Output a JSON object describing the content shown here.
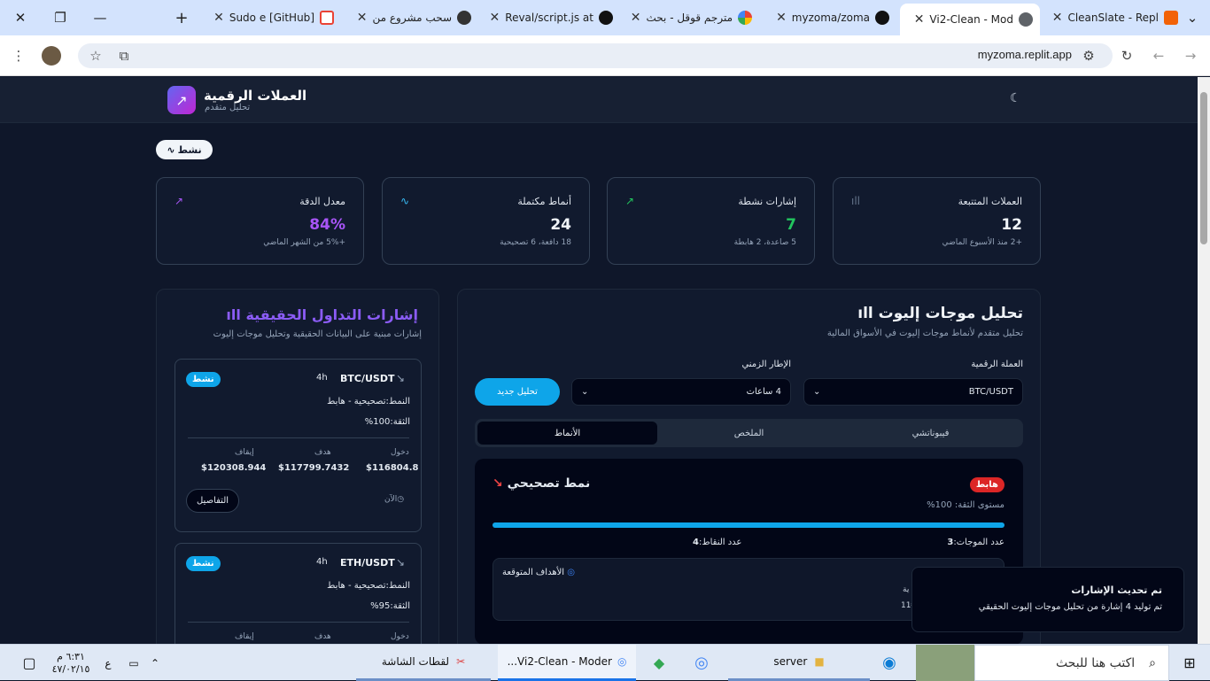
{
  "browser": {
    "tabs": [
      {
        "label": "CleanSlate - Repl",
        "active": false
      },
      {
        "label": "Vi2-Clean - Mod",
        "active": true
      },
      {
        "label": "myzoma/zoma",
        "active": false
      },
      {
        "label": "مترجم قوقل - بحث",
        "active": false
      },
      {
        "label": "Reval/script.js at",
        "active": false
      },
      {
        "label": "سحب مشروع من",
        "active": false
      },
      {
        "label": "[GitHub] Sudo e",
        "active": false
      }
    ],
    "url": "myzoma.replit.app"
  },
  "app": {
    "brand_title": "العملات الرقمية",
    "brand_subtitle": "تحليل متقدم",
    "status_label": "نشط",
    "stats": [
      {
        "title": "العملات المتتبعة",
        "value": "12",
        "note": "+2 منذ الأسبوع الماضي",
        "color": "#f1f5f9",
        "icon": "bar-chart-icon"
      },
      {
        "title": "إشارات نشطة",
        "value": "7",
        "note": "5 صاعدة، 2 هابطة",
        "color": "#22c55e",
        "icon": "trending-up-icon"
      },
      {
        "title": "أنماط مكتملة",
        "value": "24",
        "note": "18 دافعة، 6 تصحيحية",
        "color": "#f1f5f9",
        "icon": "activity-icon"
      },
      {
        "title": "معدل الدقة",
        "value": "84%",
        "note": "+5% من الشهر الماضي",
        "color": "#a855f7",
        "icon": "trending-up-icon"
      }
    ],
    "signals": {
      "title": "إشارات التداول الحقيقية",
      "subtitle": "إشارات مبنية على البيانات الحقيقية وتحليل موجات إليوت",
      "cards": [
        {
          "pair": "BTC/USDT",
          "timeframe": "4h",
          "badge": "نشط",
          "pattern_label": "النمط:",
          "pattern": "تصحيحية - هابط",
          "confidence": "الثقة:100%",
          "entry_label": "دخول",
          "target_label": "هدف",
          "stop_label": "إيقاف",
          "entry": "$116804.8",
          "target": "$117799.7432",
          "stop": "$120308.944",
          "time": "الآن",
          "details_button": "التفاصيل"
        },
        {
          "pair": "ETH/USDT",
          "timeframe": "4h",
          "badge": "نشط",
          "pattern_label": "النمط:",
          "pattern": "تصحيحية - هابط",
          "confidence": "الثقة:95%",
          "entry_label": "دخول",
          "target_label": "هدف",
          "stop_label": "إيقاف"
        }
      ]
    },
    "wave": {
      "title": "تحليل موجات إليوت",
      "subtitle": "تحليل متقدم لأنماط موجات إليوت في الأسواق المالية",
      "currency_label": "العملة الرقمية",
      "currency_value": "BTC/USDT",
      "timeframe_label": "الإطار الزمني",
      "timeframe_value": "4 ساعات",
      "analyze_button": "تحليل جديد",
      "tabs": [
        "فيبوناتشي",
        "الملخص",
        "الأنماط"
      ],
      "pattern": {
        "title": "نمط تصحيحي",
        "badge": "هابط",
        "confidence": "مستوى الثقة: 100%",
        "confidence_fraction": 1.0,
        "waves_count_label": "عدد الموجات:",
        "waves_count": "3",
        "points_count_label": "عدد النقاط:",
        "points_count": "4",
        "targets_label": "الأهداف المتوقعة",
        "partial_text_1": "ية",
        "partial_text_2": "11€"
      }
    },
    "toast": {
      "title": "تم تحديث الإشارات",
      "body": "تم توليد 4 إشارة من تحليل موجات إليوت الحقيقي"
    }
  },
  "taskbar": {
    "search_placeholder": "اكتب هنا للبحث",
    "server_label": "server",
    "chrome_window": "Vi2-Clean - Moder...",
    "snipping_label": "لقطات الشاشة",
    "time": "٦:٣١ م",
    "date": "٤٧/٠٢/١٥",
    "lang": "ع"
  }
}
